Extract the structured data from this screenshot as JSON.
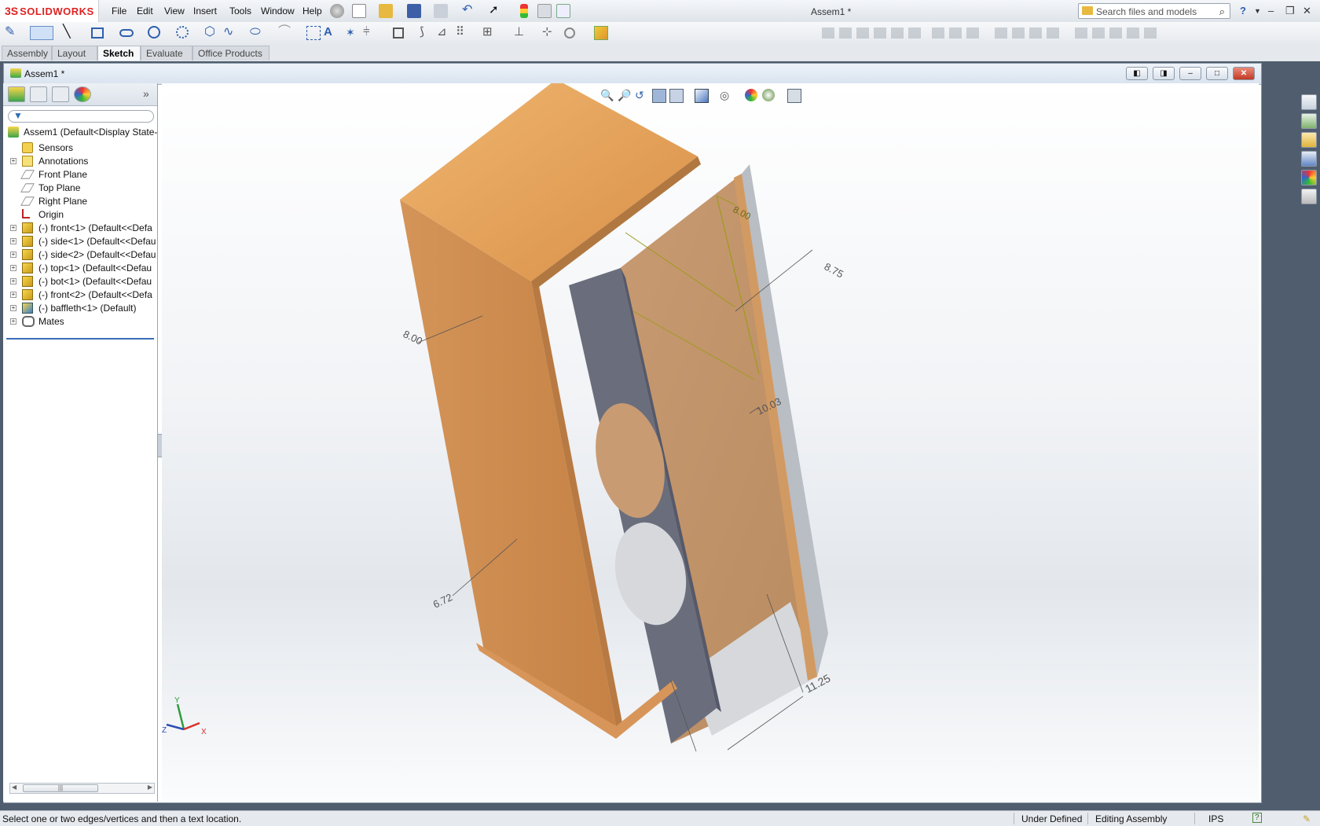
{
  "app": {
    "brand": "SOLIDWORKS",
    "brand_prefix": "3S",
    "document_title": "Assem1 *",
    "accent": "#d22222"
  },
  "menu": [
    "File",
    "Edit",
    "View",
    "Insert",
    "Tools",
    "Window",
    "Help"
  ],
  "search": {
    "placeholder": "Search files and models"
  },
  "tabs": [
    "Assembly",
    "Layout",
    "Sketch",
    "Evaluate",
    "Office Products"
  ],
  "active_tab": "Sketch",
  "document_window": {
    "title": "Assem1 *"
  },
  "feature_tree": {
    "root": "Assem1  (Default<Display State-",
    "items": [
      {
        "label": "Sensors",
        "icon": "sensor-icon",
        "expand": false
      },
      {
        "label": "Annotations",
        "icon": "annotation-icon",
        "expand": true
      },
      {
        "label": "Front Plane",
        "icon": "plane-icon",
        "expand": false
      },
      {
        "label": "Top Plane",
        "icon": "plane-icon",
        "expand": false
      },
      {
        "label": "Right Plane",
        "icon": "plane-icon",
        "expand": false
      },
      {
        "label": "Origin",
        "icon": "origin-icon",
        "expand": false
      },
      {
        "label": "(-) front<1> (Default<<Defa",
        "icon": "part-icon",
        "expand": true
      },
      {
        "label": "(-) side<1> (Default<<Defau",
        "icon": "part-icon",
        "expand": true
      },
      {
        "label": "(-) side<2> (Default<<Defau",
        "icon": "part-icon",
        "expand": true
      },
      {
        "label": "(-) top<1> (Default<<Defau",
        "icon": "part-icon",
        "expand": true
      },
      {
        "label": "(-) bot<1> (Default<<Defau",
        "icon": "part-icon",
        "expand": true
      },
      {
        "label": "(-) front<2> (Default<<Defa",
        "icon": "part-icon",
        "expand": true
      },
      {
        "label": "(-) baffleth<1> (Default)",
        "icon": "subassembly-icon",
        "expand": true
      },
      {
        "label": "Mates",
        "icon": "mates-icon",
        "expand": true
      }
    ]
  },
  "dimensions": [
    "8.00",
    "8.75",
    "8.00",
    "10.03",
    "6.72",
    "11.25"
  ],
  "triad": {
    "x": "X",
    "y": "Y",
    "z": "Z"
  },
  "status": {
    "message": "Select one or two edges/vertices and then a text location.",
    "definition": "Under Defined",
    "mode": "Editing Assembly",
    "units": "IPS"
  },
  "colors": {
    "wood_top": "#e2a15e",
    "wood_side": "#c98a4f",
    "baffle": "#676b7b",
    "dimension_highlight": "#9c9c1e"
  }
}
